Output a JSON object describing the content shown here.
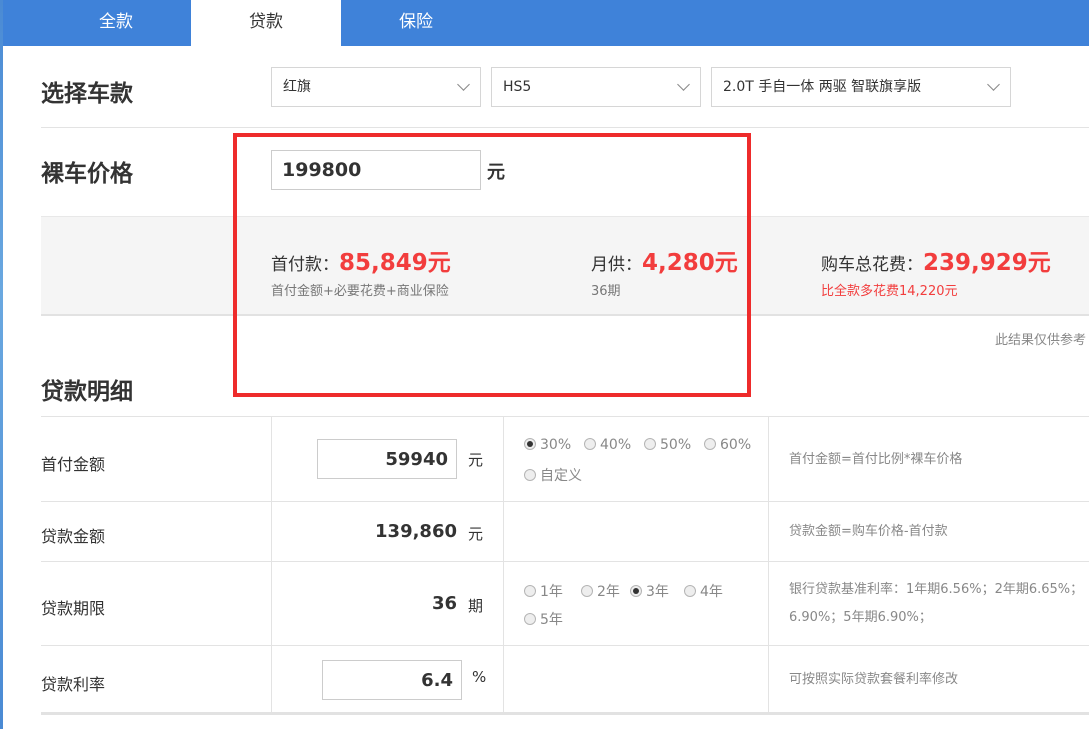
{
  "tabs": [
    {
      "label": "全款",
      "active": false
    },
    {
      "label": "贷款",
      "active": true
    },
    {
      "label": "保险",
      "active": false
    }
  ],
  "car_select": {
    "title": "选择车款",
    "brand": "红旗",
    "series": "HS5",
    "model": "2.0T 手自一体 两驱 智联旗享版"
  },
  "price": {
    "title": "裸车价格",
    "value": "199800",
    "unit": "元"
  },
  "summary": {
    "down_label": "首付款：",
    "down_value": "85,849元",
    "down_sub": "首付金额+必要花费+商业保险",
    "monthly_label": "月供：",
    "monthly_value": "4,280元",
    "monthly_sub": "36期",
    "total_label": "购车总花费：",
    "total_value": "239,929元",
    "total_sub": "比全款多花费14,220元"
  },
  "note": "此结果仅供参考",
  "loan_detail": {
    "title": "贷款明细",
    "down_payment": {
      "label": "首付金额",
      "value": "59940",
      "unit": "元",
      "options": [
        "30%",
        "40%",
        "50%",
        "60%",
        "自定义"
      ],
      "selected": "30%",
      "desc": "首付金额=首付比例*裸车价格"
    },
    "loan_amount": {
      "label": "贷款金额",
      "value": "139,860",
      "unit": "元",
      "desc": "贷款金额=购车价格-首付款"
    },
    "loan_term": {
      "label": "贷款期限",
      "value": "36",
      "unit": "期",
      "options": [
        "1年",
        "2年",
        "3年",
        "4年",
        "5年"
      ],
      "selected": "3年",
      "desc_line1": "银行贷款基准利率：1年期6.56%；2年期6.65%；",
      "desc_line2": "6.90%；5年期6.90%；"
    },
    "loan_rate": {
      "label": "贷款利率",
      "value": "6.4",
      "unit": "%",
      "desc": "可按照实际贷款套餐利率修改"
    }
  }
}
